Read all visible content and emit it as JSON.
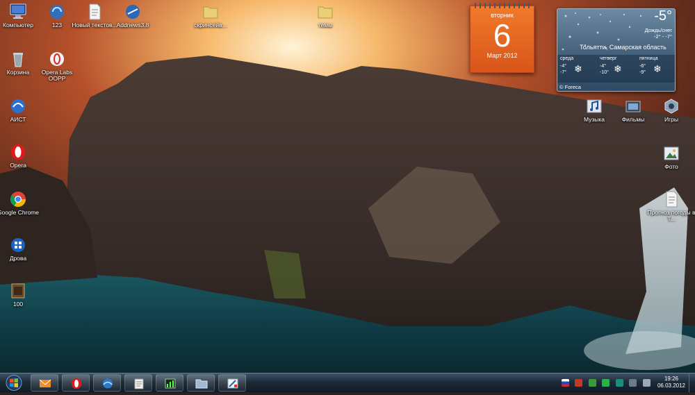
{
  "desktop_icons_left": [
    {
      "label": "Компьютер",
      "icon": "computer-icon"
    },
    {
      "label": "Корзина",
      "icon": "recycle-bin-icon"
    },
    {
      "label": "АИСТ",
      "icon": "aist-icon"
    },
    {
      "label": "Opera",
      "icon": "opera-icon"
    },
    {
      "label": "Google Chrome",
      "icon": "chrome-icon"
    },
    {
      "label": "Дрова",
      "icon": "drivers-icon"
    },
    {
      "label": "100",
      "icon": "game-icon"
    }
  ],
  "desktop_icons_col2": [
    {
      "label": "123",
      "icon": "app-icon"
    },
    {
      "label": "Opera Labs OOPP",
      "icon": "opera-labs-icon"
    }
  ],
  "desktop_icons_top": [
    {
      "label": "Новый текстов...",
      "icon": "text-document-icon"
    },
    {
      "label": "Addnews3.8",
      "icon": "addnews-icon"
    },
    {
      "label": "скринсейв...",
      "icon": "folder-icon"
    },
    {
      "label": "темы",
      "icon": "folder-icon"
    }
  ],
  "desktop_icons_right": [
    {
      "label": "Музыка",
      "icon": "music-icon"
    },
    {
      "label": "Фильмы",
      "icon": "movies-icon"
    },
    {
      "label": "Игры",
      "icon": "games-icon"
    },
    {
      "label": "Фото",
      "icon": "photo-icon"
    },
    {
      "label": "Прогноз погоды в Т...",
      "icon": "forecast-document-icon"
    }
  ],
  "calendar": {
    "weekday": "вторник",
    "day": "6",
    "month": "Март 2012"
  },
  "weather": {
    "temp": "-5°",
    "condition": "Дождь/снег",
    "range": "-2° - -7°",
    "location": "Тольятти, Самарская область",
    "forecast": [
      {
        "day": "среда",
        "high": "-4°",
        "low": "-7°"
      },
      {
        "day": "четверг",
        "high": "-4°",
        "low": "-10°"
      },
      {
        "day": "пятница",
        "high": "-6°",
        "low": "-9°"
      }
    ],
    "credit": "© Foreca"
  },
  "taskbar": {
    "pinned": [
      {
        "icon": "mail-icon"
      },
      {
        "icon": "opera-icon"
      },
      {
        "icon": "browser-icon"
      },
      {
        "icon": "notepad-icon"
      },
      {
        "icon": "task-manager-icon"
      },
      {
        "icon": "explorer-folder-icon"
      },
      {
        "icon": "paint-icon"
      }
    ],
    "clock": {
      "time": "19:26",
      "date": "06.03.2012"
    }
  },
  "colors": {
    "calendar": "#e8661f",
    "weather_panel": "#4f6c86",
    "taskbar": "#1d2b39"
  }
}
